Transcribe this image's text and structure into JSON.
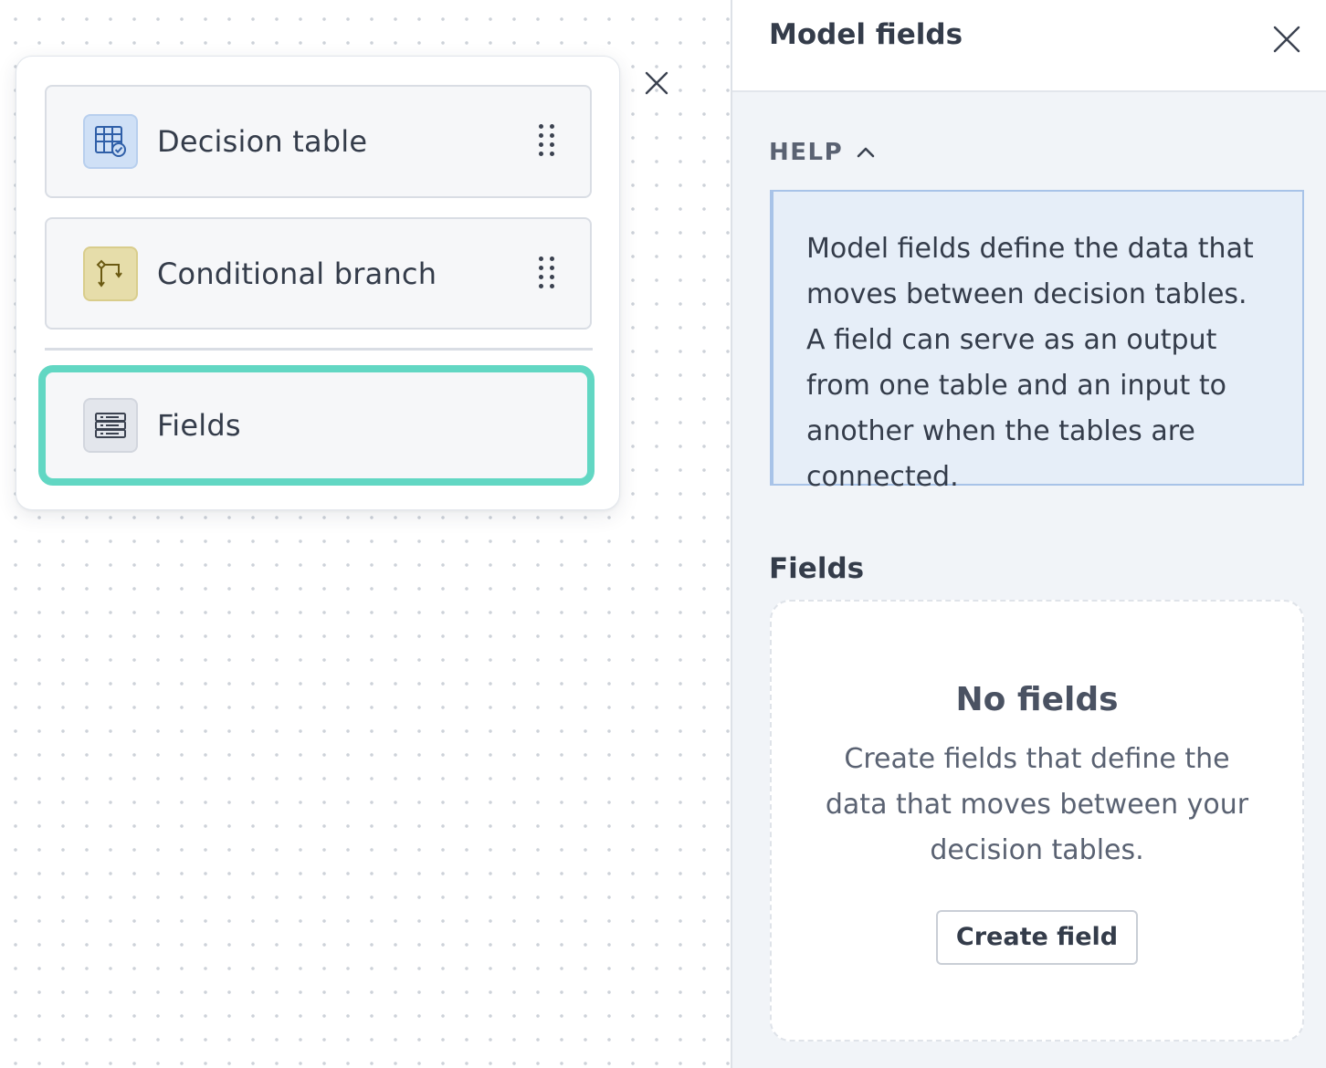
{
  "canvas": {
    "blocks": [
      {
        "label": "Decision table",
        "icon": "decision-table-icon",
        "icon_color": "#cfe0f6"
      },
      {
        "label": "Conditional branch",
        "icon": "conditional-branch-icon",
        "icon_color": "#e6ddaa"
      },
      {
        "label": "Fields",
        "icon": "fields-icon",
        "icon_color": "#e3e6ec",
        "selected": true
      }
    ],
    "selection_color": "#62d7c3"
  },
  "panel": {
    "title": "Model fields",
    "help": {
      "label": "HELP",
      "expanded": true,
      "text": "Model fields define the data that moves between decision tables. A field can serve as an output from one table and an input to another when the tables are connected."
    },
    "fields_section": {
      "heading": "Fields",
      "empty_title": "No fields",
      "empty_description": "Create fields that define the data that moves between your decision tables.",
      "create_button": "Create field"
    }
  }
}
